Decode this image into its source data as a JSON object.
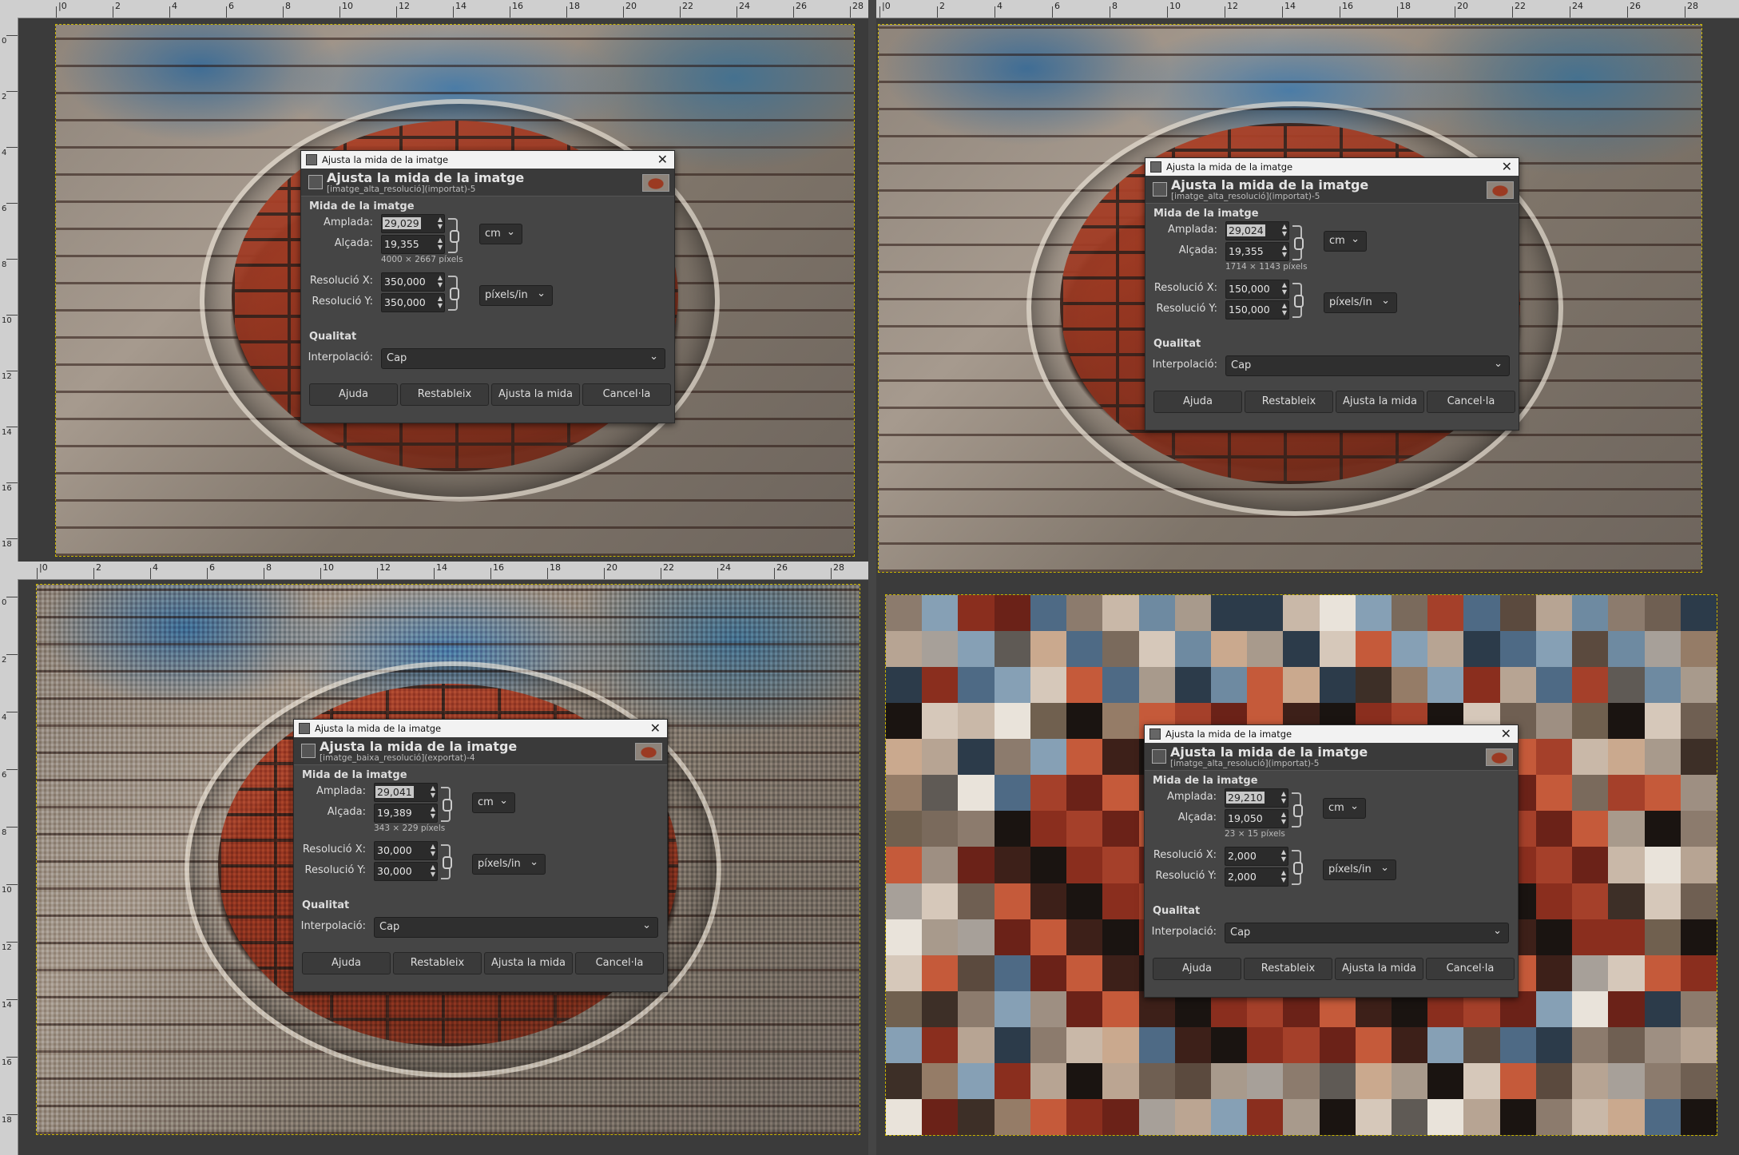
{
  "panels": [
    {
      "ruler_h": [
        "|0",
        "2",
        "4",
        "6",
        "8",
        "10",
        "12",
        "14",
        "16",
        "18",
        "20",
        "22",
        "24",
        "26",
        "28"
      ],
      "ruler_v": [
        "0",
        "2",
        "4",
        "6",
        "8",
        "10",
        "12",
        "14",
        "16",
        "18"
      ],
      "style": "photo",
      "dialog": {
        "window_title": "Ajusta la mida de la imatge",
        "heading": "Ajusta la mida de la imatge",
        "subheading": "[imatge_alta_resolució](importat)-5",
        "section_size": "Mida de la imatge",
        "width_label": "Amplada:",
        "width_value": "29,029",
        "height_label": "Alçada:",
        "height_value": "19,355",
        "size_unit": "cm",
        "pixels_text": "4000 × 2667 píxels",
        "res_x_label": "Resolució X:",
        "res_x_value": "350,000",
        "res_y_label": "Resolució Y:",
        "res_y_value": "350,000",
        "res_unit": "píxels/in",
        "section_quality": "Qualitat",
        "interp_label": "Interpolació:",
        "interp_value": "Cap",
        "btn_help": "Ajuda",
        "btn_reset": "Restableix",
        "btn_scale": "Ajusta la mida",
        "btn_cancel": "Cancel·la"
      }
    },
    {
      "ruler_h": [
        "|0",
        "2",
        "4",
        "6",
        "8",
        "10",
        "12",
        "14",
        "16",
        "18",
        "20",
        "22",
        "24",
        "26",
        "28"
      ],
      "ruler_v": [],
      "style": "photo",
      "dialog": {
        "window_title": "Ajusta la mida de la imatge",
        "heading": "Ajusta la mida de la imatge",
        "subheading": "[imatge_alta_resolució](importat)-5",
        "section_size": "Mida de la imatge",
        "width_label": "Amplada:",
        "width_value": "29,024",
        "height_label": "Alçada:",
        "height_value": "19,355",
        "size_unit": "cm",
        "pixels_text": "1714 × 1143 píxels",
        "res_x_label": "Resolució X:",
        "res_x_value": "150,000",
        "res_y_label": "Resolució Y:",
        "res_y_value": "150,000",
        "res_unit": "píxels/in",
        "section_quality": "Qualitat",
        "interp_label": "Interpolació:",
        "interp_value": "Cap",
        "btn_help": "Ajuda",
        "btn_reset": "Restableix",
        "btn_scale": "Ajusta la mida",
        "btn_cancel": "Cancel·la"
      }
    },
    {
      "ruler_h": [
        "|0",
        "2",
        "4",
        "6",
        "8",
        "10",
        "12",
        "14",
        "16",
        "18",
        "20",
        "22",
        "24",
        "26",
        "28"
      ],
      "ruler_v": [
        "0",
        "2",
        "4",
        "6",
        "8",
        "10",
        "12",
        "14",
        "16",
        "18"
      ],
      "style": "noisy",
      "dialog": {
        "window_title": "Ajusta la mida de la imatge",
        "heading": "Ajusta la mida de la imatge",
        "subheading": "[imatge_baixa_resolució](exportat)-4",
        "section_size": "Mida de la imatge",
        "width_label": "Amplada:",
        "width_value": "29,041",
        "height_label": "Alçada:",
        "height_value": "19,389",
        "size_unit": "cm",
        "pixels_text": "343 × 229 píxels",
        "res_x_label": "Resolució X:",
        "res_x_value": "30,000",
        "res_y_label": "Resolució Y:",
        "res_y_value": "30,000",
        "res_unit": "píxels/in",
        "section_quality": "Qualitat",
        "interp_label": "Interpolació:",
        "interp_value": "Cap",
        "btn_help": "Ajuda",
        "btn_reset": "Restableix",
        "btn_scale": "Ajusta la mida",
        "btn_cancel": "Cancel·la"
      }
    },
    {
      "ruler_h": [],
      "ruler_v": [],
      "style": "mosaic",
      "dialog": {
        "window_title": "Ajusta la mida de la imatge",
        "heading": "Ajusta la mida de la imatge",
        "subheading": "[imatge_alta_resolució](importat)-5",
        "section_size": "Mida de la imatge",
        "width_label": "Amplada:",
        "width_value": "29,210",
        "height_label": "Alçada:",
        "height_value": "19,050",
        "size_unit": "cm",
        "pixels_text": "23 × 15 píxels",
        "res_x_label": "Resolució X:",
        "res_x_value": "2,000",
        "res_y_label": "Resolució Y:",
        "res_y_value": "2,000",
        "res_unit": "píxels/in",
        "section_quality": "Qualitat",
        "interp_label": "Interpolació:",
        "interp_value": "Cap",
        "btn_help": "Ajuda",
        "btn_reset": "Restableix",
        "btn_scale": "Ajusta la mida",
        "btn_cancel": "Cancel·la"
      }
    }
  ],
  "icons": {
    "close": "close-icon",
    "chain": "chain-link-icon",
    "chevron": "chevron-down-icon"
  },
  "colors": {
    "dialog_bg": "#454545",
    "canvas_border": "#c8b400",
    "ruler_bg": "#cfcfcf"
  }
}
